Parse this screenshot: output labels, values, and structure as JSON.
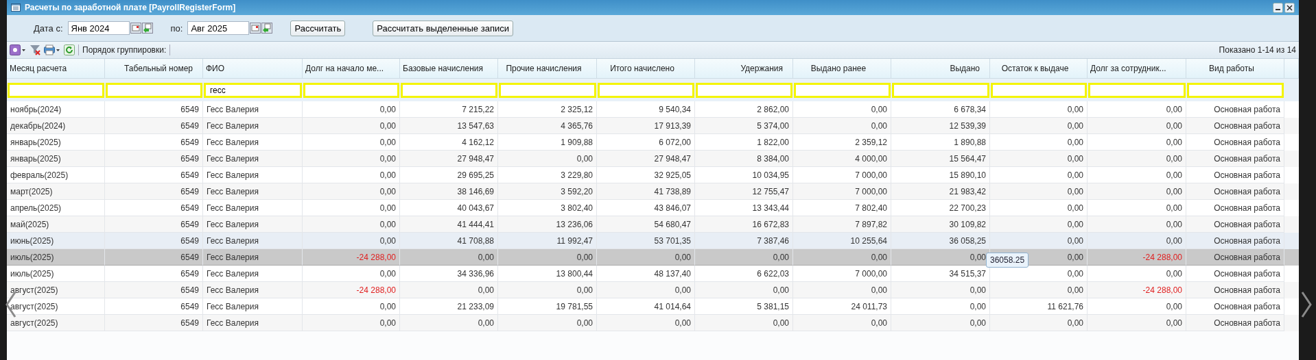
{
  "window": {
    "title": "Расчеты по заработной плате [PayrollRegisterForm]"
  },
  "date_bar": {
    "from_label": "Дата с:",
    "from_value": "Янв 2024",
    "to_label": "по:",
    "to_value": "Авг 2025",
    "buttons": [
      "Рассчитать",
      "Рассчитать выделенные записи"
    ]
  },
  "toolbar": {
    "grouping_label": "Порядок группировки:",
    "paging_info": "Показано 1-14 из 14"
  },
  "table": {
    "columns": [
      {
        "title": "Месяц расчета"
      },
      {
        "title": "Табельный номер"
      },
      {
        "title": "ФИО",
        "filter": "гесс"
      },
      {
        "title": "Долг на начало ме..."
      },
      {
        "title": "Базовые начисления"
      },
      {
        "title": "Прочие начисления"
      },
      {
        "title": "Итого начислено"
      },
      {
        "title": "Удержания"
      },
      {
        "title": "Выдано ранее"
      },
      {
        "title": "Выдано"
      },
      {
        "title": "Остаток к выдаче"
      },
      {
        "title": "Долг за сотрудник..."
      },
      {
        "title": "Вид работы"
      }
    ],
    "rows": [
      {
        "selected": false,
        "hovered": false,
        "cells": [
          {
            "text": "ноябрь(2024)",
            "red": false
          },
          {
            "text": "6549",
            "red": false
          },
          {
            "text": "Гесс Валерия",
            "red": false
          },
          {
            "text": "0,00",
            "red": false
          },
          {
            "text": "7 215,22",
            "red": false
          },
          {
            "text": "2 325,12",
            "red": false
          },
          {
            "text": "9 540,34",
            "red": false
          },
          {
            "text": "2 862,00",
            "red": false
          },
          {
            "text": "0,00",
            "red": false
          },
          {
            "text": "6 678,34",
            "red": false
          },
          {
            "text": "0,00",
            "red": false
          },
          {
            "text": "0,00",
            "red": false
          },
          {
            "text": "Основная работа",
            "red": false
          }
        ]
      },
      {
        "selected": false,
        "hovered": false,
        "cells": [
          {
            "text": "декабрь(2024)",
            "red": false
          },
          {
            "text": "6549",
            "red": false
          },
          {
            "text": "Гесс Валерия",
            "red": false
          },
          {
            "text": "0,00",
            "red": false
          },
          {
            "text": "13 547,63",
            "red": false
          },
          {
            "text": "4 365,76",
            "red": false
          },
          {
            "text": "17 913,39",
            "red": false
          },
          {
            "text": "5 374,00",
            "red": false
          },
          {
            "text": "0,00",
            "red": false
          },
          {
            "text": "12 539,39",
            "red": false
          },
          {
            "text": "0,00",
            "red": false
          },
          {
            "text": "0,00",
            "red": false
          },
          {
            "text": "Основная работа",
            "red": false
          }
        ]
      },
      {
        "selected": false,
        "hovered": false,
        "cells": [
          {
            "text": "январь(2025)",
            "red": false
          },
          {
            "text": "6549",
            "red": false
          },
          {
            "text": "Гесс Валерия",
            "red": false
          },
          {
            "text": "0,00",
            "red": false
          },
          {
            "text": "4 162,12",
            "red": false
          },
          {
            "text": "1 909,88",
            "red": false
          },
          {
            "text": "6 072,00",
            "red": false
          },
          {
            "text": "1 822,00",
            "red": false
          },
          {
            "text": "2 359,12",
            "red": false
          },
          {
            "text": "1 890,88",
            "red": false
          },
          {
            "text": "0,00",
            "red": false
          },
          {
            "text": "0,00",
            "red": false
          },
          {
            "text": "Основная работа",
            "red": false
          }
        ]
      },
      {
        "selected": false,
        "hovered": false,
        "cells": [
          {
            "text": "январь(2025)",
            "red": false
          },
          {
            "text": "6549",
            "red": false
          },
          {
            "text": "Гесс Валерия",
            "red": false
          },
          {
            "text": "0,00",
            "red": false
          },
          {
            "text": "27 948,47",
            "red": false
          },
          {
            "text": "0,00",
            "red": false
          },
          {
            "text": "27 948,47",
            "red": false
          },
          {
            "text": "8 384,00",
            "red": false
          },
          {
            "text": "4 000,00",
            "red": false
          },
          {
            "text": "15 564,47",
            "red": false
          },
          {
            "text": "0,00",
            "red": false
          },
          {
            "text": "0,00",
            "red": false
          },
          {
            "text": "Основная работа",
            "red": false
          }
        ]
      },
      {
        "selected": false,
        "hovered": false,
        "cells": [
          {
            "text": "февраль(2025)",
            "red": false
          },
          {
            "text": "6549",
            "red": false
          },
          {
            "text": "Гесс Валерия",
            "red": false
          },
          {
            "text": "0,00",
            "red": false
          },
          {
            "text": "29 695,25",
            "red": false
          },
          {
            "text": "3 229,80",
            "red": false
          },
          {
            "text": "32 925,05",
            "red": false
          },
          {
            "text": "10 034,95",
            "red": false
          },
          {
            "text": "7 000,00",
            "red": false
          },
          {
            "text": "15 890,10",
            "red": false
          },
          {
            "text": "0,00",
            "red": false
          },
          {
            "text": "0,00",
            "red": false
          },
          {
            "text": "Основная работа",
            "red": false
          }
        ]
      },
      {
        "selected": false,
        "hovered": false,
        "cells": [
          {
            "text": "март(2025)",
            "red": false
          },
          {
            "text": "6549",
            "red": false
          },
          {
            "text": "Гесс Валерия",
            "red": false
          },
          {
            "text": "0,00",
            "red": false
          },
          {
            "text": "38 146,69",
            "red": false
          },
          {
            "text": "3 592,20",
            "red": false
          },
          {
            "text": "41 738,89",
            "red": false
          },
          {
            "text": "12 755,47",
            "red": false
          },
          {
            "text": "7 000,00",
            "red": false
          },
          {
            "text": "21 983,42",
            "red": false
          },
          {
            "text": "0,00",
            "red": false
          },
          {
            "text": "0,00",
            "red": false
          },
          {
            "text": "Основная работа",
            "red": false
          }
        ]
      },
      {
        "selected": false,
        "hovered": false,
        "cells": [
          {
            "text": "апрель(2025)",
            "red": false
          },
          {
            "text": "6549",
            "red": false
          },
          {
            "text": "Гесс Валерия",
            "red": false
          },
          {
            "text": "0,00",
            "red": false
          },
          {
            "text": "40 043,67",
            "red": false
          },
          {
            "text": "3 802,40",
            "red": false
          },
          {
            "text": "43 846,07",
            "red": false
          },
          {
            "text": "13 343,44",
            "red": false
          },
          {
            "text": "7 802,40",
            "red": false
          },
          {
            "text": "22 700,23",
            "red": false
          },
          {
            "text": "0,00",
            "red": false
          },
          {
            "text": "0,00",
            "red": false
          },
          {
            "text": "Основная работа",
            "red": false
          }
        ]
      },
      {
        "selected": false,
        "hovered": false,
        "cells": [
          {
            "text": "май(2025)",
            "red": false
          },
          {
            "text": "6549",
            "red": false
          },
          {
            "text": "Гесс Валерия",
            "red": false
          },
          {
            "text": "0,00",
            "red": false
          },
          {
            "text": "41 444,41",
            "red": false
          },
          {
            "text": "13 236,06",
            "red": false
          },
          {
            "text": "54 680,47",
            "red": false
          },
          {
            "text": "16 672,83",
            "red": false
          },
          {
            "text": "7 897,82",
            "red": false
          },
          {
            "text": "30 109,82",
            "red": false
          },
          {
            "text": "0,00",
            "red": false
          },
          {
            "text": "0,00",
            "red": false
          },
          {
            "text": "Основная работа",
            "red": false
          }
        ]
      },
      {
        "selected": false,
        "hovered": true,
        "cells": [
          {
            "text": "июнь(2025)",
            "red": false
          },
          {
            "text": "6549",
            "red": false
          },
          {
            "text": "Гесс Валерия",
            "red": false
          },
          {
            "text": "0,00",
            "red": false
          },
          {
            "text": "41 708,88",
            "red": false
          },
          {
            "text": "11 992,47",
            "red": false
          },
          {
            "text": "53 701,35",
            "red": false
          },
          {
            "text": "7 387,46",
            "red": false
          },
          {
            "text": "10 255,64",
            "red": false
          },
          {
            "text": "36 058,25",
            "red": false
          },
          {
            "text": "0,00",
            "red": false
          },
          {
            "text": "0,00",
            "red": false
          },
          {
            "text": "Основная работа",
            "red": false
          }
        ]
      },
      {
        "selected": true,
        "hovered": false,
        "cells": [
          {
            "text": "июль(2025)",
            "red": false
          },
          {
            "text": "6549",
            "red": false
          },
          {
            "text": "Гесс Валерия",
            "red": false
          },
          {
            "text": "-24 288,00",
            "red": true
          },
          {
            "text": "0,00",
            "red": false
          },
          {
            "text": "0,00",
            "red": false
          },
          {
            "text": "0,00",
            "red": false
          },
          {
            "text": "0,00",
            "red": false
          },
          {
            "text": "0,00",
            "red": false
          },
          {
            "text": "0,00",
            "red": false,
            "tooltip": "36058.25"
          },
          {
            "text": "0,00",
            "red": false
          },
          {
            "text": "-24 288,00",
            "red": true
          },
          {
            "text": "Основная работа",
            "red": false
          }
        ]
      },
      {
        "selected": false,
        "hovered": false,
        "cells": [
          {
            "text": "июль(2025)",
            "red": false
          },
          {
            "text": "6549",
            "red": false
          },
          {
            "text": "Гесс Валерия",
            "red": false
          },
          {
            "text": "0,00",
            "red": false
          },
          {
            "text": "34 336,96",
            "red": false
          },
          {
            "text": "13 800,44",
            "red": false
          },
          {
            "text": "48 137,40",
            "red": false
          },
          {
            "text": "6 622,03",
            "red": false
          },
          {
            "text": "7 000,00",
            "red": false
          },
          {
            "text": "34 515,37",
            "red": false
          },
          {
            "text": "0,00",
            "red": false
          },
          {
            "text": "0,00",
            "red": false
          },
          {
            "text": "Основная работа",
            "red": false
          }
        ]
      },
      {
        "selected": false,
        "hovered": false,
        "cells": [
          {
            "text": "август(2025)",
            "red": false
          },
          {
            "text": "6549",
            "red": false
          },
          {
            "text": "Гесс Валерия",
            "red": false
          },
          {
            "text": "-24 288,00",
            "red": true
          },
          {
            "text": "0,00",
            "red": false
          },
          {
            "text": "0,00",
            "red": false
          },
          {
            "text": "0,00",
            "red": false
          },
          {
            "text": "0,00",
            "red": false
          },
          {
            "text": "0,00",
            "red": false
          },
          {
            "text": "0,00",
            "red": false
          },
          {
            "text": "0,00",
            "red": false
          },
          {
            "text": "-24 288,00",
            "red": true
          },
          {
            "text": "Основная работа",
            "red": false
          }
        ]
      },
      {
        "selected": false,
        "hovered": false,
        "cells": [
          {
            "text": "август(2025)",
            "red": false
          },
          {
            "text": "6549",
            "red": false
          },
          {
            "text": "Гесс Валерия",
            "red": false
          },
          {
            "text": "0,00",
            "red": false
          },
          {
            "text": "21 233,09",
            "red": false
          },
          {
            "text": "19 781,55",
            "red": false
          },
          {
            "text": "41 014,64",
            "red": false
          },
          {
            "text": "5 381,15",
            "red": false
          },
          {
            "text": "24 011,73",
            "red": false
          },
          {
            "text": "0,00",
            "red": false
          },
          {
            "text": "11 621,76",
            "red": false
          },
          {
            "text": "0,00",
            "red": false
          },
          {
            "text": "Основная работа",
            "red": false
          }
        ]
      },
      {
        "selected": false,
        "hovered": false,
        "cells": [
          {
            "text": "август(2025)",
            "red": false
          },
          {
            "text": "6549",
            "red": false
          },
          {
            "text": "Гесс Валерия",
            "red": false
          },
          {
            "text": "0,00",
            "red": false
          },
          {
            "text": "0,00",
            "red": false
          },
          {
            "text": "0,00",
            "red": false
          },
          {
            "text": "0,00",
            "red": false
          },
          {
            "text": "0,00",
            "red": false
          },
          {
            "text": "0,00",
            "red": false
          },
          {
            "text": "0,00",
            "red": false
          },
          {
            "text": "0,00",
            "red": false
          },
          {
            "text": "0,00",
            "red": false
          },
          {
            "text": "Основная работа",
            "red": false
          }
        ]
      }
    ]
  }
}
